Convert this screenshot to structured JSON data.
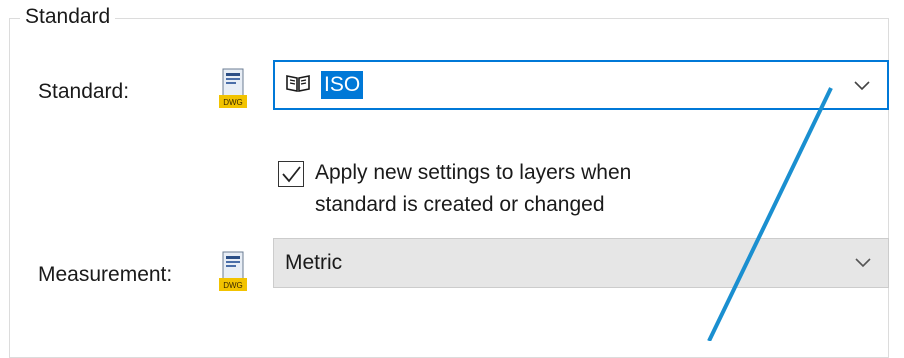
{
  "group": {
    "title": "Standard"
  },
  "standard_field": {
    "label": "Standard:",
    "value": "ISO",
    "icon": "dwg-file-icon"
  },
  "apply_option": {
    "checked": true,
    "label_line1": "Apply new settings to layers when",
    "label_line2": "standard is created or changed"
  },
  "measurement_field": {
    "label": "Measurement:",
    "value": "Metric",
    "icon": "dwg-file-icon"
  },
  "colors": {
    "accent": "#0078d7",
    "annotation_line": "#1a8fd0",
    "disabled_bg": "#e6e6e6"
  }
}
